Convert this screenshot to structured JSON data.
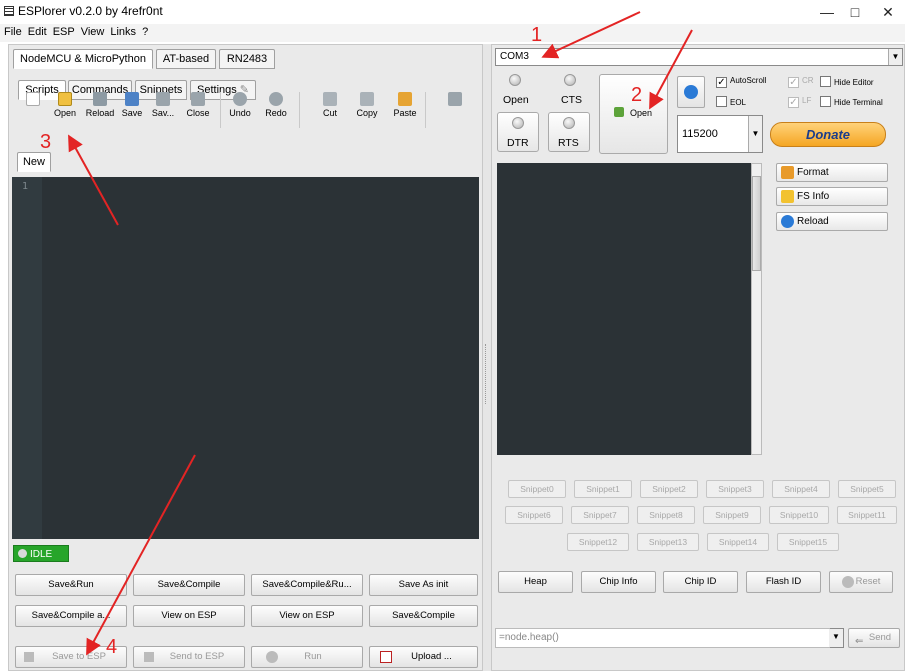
{
  "window": {
    "title": "ESPlorer v0.2.0 by 4refr0nt",
    "minimize": "—",
    "maximize": "□",
    "close": "✕"
  },
  "menu": [
    "File",
    "Edit",
    "ESP",
    "View",
    "Links",
    "?"
  ],
  "top_tabs": [
    "NodeMCU & MicroPython",
    "AT-based",
    "RN2483"
  ],
  "sub_tabs": [
    "Scripts",
    "Commands",
    "Snippets",
    "Settings"
  ],
  "toolbar": [
    "Open",
    "Reload",
    "Save",
    "Sav...",
    "Close",
    "Undo",
    "Redo",
    "Cut",
    "Copy",
    "Paste"
  ],
  "file_tab": "New",
  "editor": {
    "line_number": "1"
  },
  "status": "IDLE",
  "bottom_buttons": {
    "row1": [
      "Save&Run",
      "Save&Compile",
      "Save&Compile&Ru...",
      "Save As init"
    ],
    "row2": [
      "Save&Compile a...",
      "View on ESP",
      "View on ESP",
      "Save&Compile"
    ],
    "row3": [
      "Save to ESP",
      "Send to ESP",
      "Run",
      "Upload ..."
    ]
  },
  "port": {
    "selected": "COM3"
  },
  "signals": {
    "open": "Open",
    "cts": "CTS",
    "dtr": "DTR",
    "rts": "RTS"
  },
  "open_button": "Open",
  "baud": "115200",
  "checkboxes": {
    "autoscroll": "AutoScroll",
    "eol": "EOL",
    "cr": "CR",
    "lf": "LF",
    "hide_editor": "Hide Editor",
    "hide_terminal": "Hide Terminal"
  },
  "donate": "Donate",
  "side_buttons": [
    "Format",
    "FS Info",
    "Reload"
  ],
  "snippets": [
    "Snippet0",
    "Snippet1",
    "Snippet2",
    "Snippet3",
    "Snippet4",
    "Snippet5",
    "Snippet6",
    "Snippet7",
    "Snippet8",
    "Snippet9",
    "Snippet10",
    "Snippet11",
    "Snippet12",
    "Snippet13",
    "Snippet14",
    "Snippet15"
  ],
  "info_buttons": [
    "Heap",
    "Chip Info",
    "Chip ID",
    "Flash ID",
    "Reset"
  ],
  "command_input": "=node.heap()",
  "send": "Send",
  "annotations": [
    "1",
    "2",
    "3",
    "4"
  ],
  "colors": {
    "annotation": "#e32424",
    "editor_bg": "#2b3236",
    "idle_green": "#27a52a",
    "donate_orange": "#f5a623"
  }
}
